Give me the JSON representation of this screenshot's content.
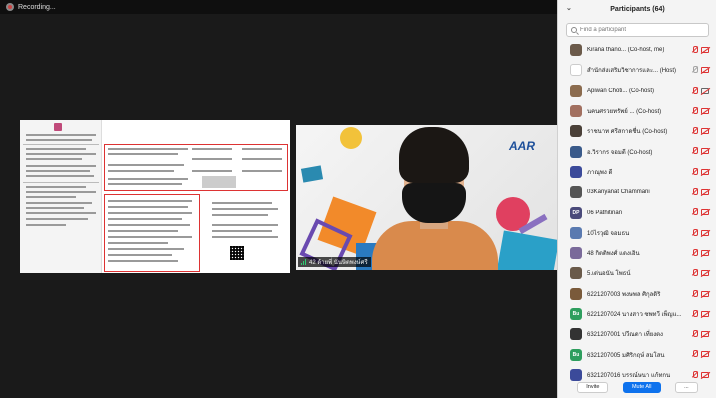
{
  "recording": {
    "label": "Recording..."
  },
  "panel": {
    "title": "Participants (64)",
    "search_placeholder": "Find a participant",
    "participants": [
      {
        "name": "Kirana thano... (Co-host, me)",
        "avatar_color": "#6b5a4a",
        "mic_state": "muted",
        "cam_state": "off"
      },
      {
        "name": "สำนักส่งเสริมวิชาการและ... (Host)",
        "avatar_color": "#ffffff",
        "mic_state": "on",
        "cam_state": "off"
      },
      {
        "name": "Apiwan Choti... (Co-host)",
        "avatar_color": "#8b6b4e",
        "mic_state": "muted",
        "cam_state": "on"
      },
      {
        "name": "นคนศรวยทรัพย์ ... (Co-host)",
        "avatar_color": "#a27060",
        "mic_state": "muted",
        "cam_state": "off"
      },
      {
        "name": "ราชนาท ศรีสกาดชื่น (Co-host)",
        "avatar_color": "#4a4038",
        "mic_state": "muted",
        "cam_state": "off"
      },
      {
        "name": "อ.วิรากร จอมดี (Co-host)",
        "avatar_color": "#3a5a8a",
        "mic_state": "muted",
        "cam_state": "off"
      },
      {
        "name": "ภาณุพง ดี",
        "avatar_color": "#3b4a9a",
        "mic_state": "muted",
        "cam_state": "off"
      },
      {
        "name": "03Kanyanat Chammani",
        "avatar_color": "#555",
        "mic_state": "muted",
        "cam_state": "off"
      },
      {
        "name": "06 Pathitinan",
        "avatar_color": "#4a4a7a",
        "mic_state": "muted",
        "cam_state": "off"
      },
      {
        "name": "10ไรวุฒิ จอมธน",
        "avatar_color": "#5a7ab0",
        "mic_state": "muted",
        "cam_state": "off"
      },
      {
        "name": "48 กิตติพงศ์ แดงเอิน",
        "avatar_color": "#7a6a9a",
        "mic_state": "muted",
        "cam_state": "off"
      },
      {
        "name": "5.เด่นอนัน โพธน์",
        "avatar_color": "#6a5a4a",
        "mic_state": "muted",
        "cam_state": "off"
      },
      {
        "name": "6221207003 พงษพล ศิกุลดิริ",
        "avatar_color": "#7a5a3a",
        "mic_state": "muted",
        "cam_state": "off"
      },
      {
        "name": "6221207024 นางสาว ซพทวี เพ็ญแ...",
        "avatar_color": "#2e9e5e",
        "mic_state": "muted",
        "cam_state": "off"
      },
      {
        "name": "6321207001 ปวีณดา เที่ยงตง",
        "avatar_color": "#333",
        "mic_state": "muted",
        "cam_state": "off"
      },
      {
        "name": "6321207005 มศิริกฤษ์ สมโสน",
        "avatar_color": "#2e9e5e",
        "mic_state": "muted",
        "cam_state": "off"
      },
      {
        "name": "6321207016 บรรณ์ษนา แก้ทกน",
        "avatar_color": "#3b4a9a",
        "mic_state": "muted",
        "cam_state": "off"
      }
    ],
    "avatar_initials": {
      "6": "",
      "8": "DP",
      "13": "Bu",
      "15": "Bu"
    },
    "invite_label": "Invite",
    "mute_all_label": "Mute All",
    "more_label": "..."
  },
  "camera": {
    "name_tag": "42 ด้ายพี่ นันษิตพงษ์ศรี",
    "logo_text": "AAR"
  },
  "colors": {
    "accent": "#0e72ed",
    "muted": "#d33333"
  }
}
